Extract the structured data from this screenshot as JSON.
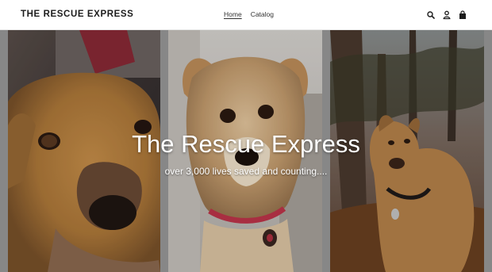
{
  "header": {
    "logo_text": "THE RESCUE EXPRESS",
    "nav": [
      {
        "label": "Home",
        "active": true
      },
      {
        "label": "Catalog",
        "active": false
      }
    ],
    "icons": [
      "search-icon",
      "account-icon",
      "cart-icon"
    ]
  },
  "hero": {
    "title": "The Rescue Express",
    "subtitle": "over 3,000 lives saved and counting....",
    "images": [
      "dog-photo-left",
      "dog-photo-center",
      "dog-photo-right"
    ]
  },
  "colors": {
    "header_bg": "#ffffff",
    "hero_text": "#ffffff",
    "logo_text": "#1c1c1c"
  }
}
